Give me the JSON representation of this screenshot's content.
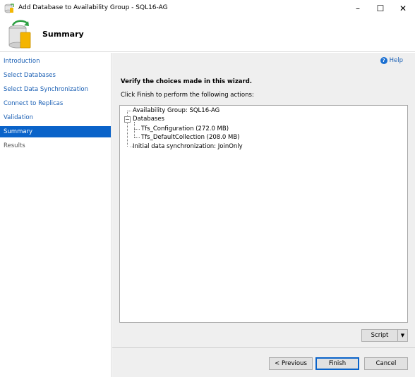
{
  "window": {
    "title": "Add Database to Availability Group - SQL16-AG",
    "controls": {
      "minimize": "–",
      "maximize": "☐",
      "close": "✕"
    }
  },
  "header": {
    "title": "Summary",
    "icon": "database-wizard-icon"
  },
  "sidebar": {
    "items": [
      {
        "label": "Introduction",
        "state": "link"
      },
      {
        "label": "Select Databases",
        "state": "link"
      },
      {
        "label": "Select Data Synchronization",
        "state": "link"
      },
      {
        "label": "Connect to Replicas",
        "state": "link"
      },
      {
        "label": "Validation",
        "state": "link"
      },
      {
        "label": "Summary",
        "state": "active"
      },
      {
        "label": "Results",
        "state": "disabled"
      }
    ]
  },
  "main": {
    "help_label": "Help",
    "help_icon": "question-icon",
    "heading": "Verify the choices made in this wizard.",
    "subheading": "Click Finish to perform the following actions:",
    "tree": {
      "availability_group": "Availability Group: SQL16-AG",
      "databases_label": "Databases",
      "databases_expander": "−",
      "databases": [
        "Tfs_Configuration (272.0 MB)",
        "Tfs_DefaultCollection (208.0 MB)"
      ],
      "initial_sync": "Initial data synchronization: JoinOnly"
    },
    "script_label": "Script",
    "script_arrow": "▼"
  },
  "footer": {
    "previous_label": "< Previous",
    "finish_label": "Finish",
    "cancel_label": "Cancel"
  },
  "colors": {
    "accent": "#0a63c9",
    "link": "#1a5fb4",
    "panel_bg": "#efefef"
  }
}
